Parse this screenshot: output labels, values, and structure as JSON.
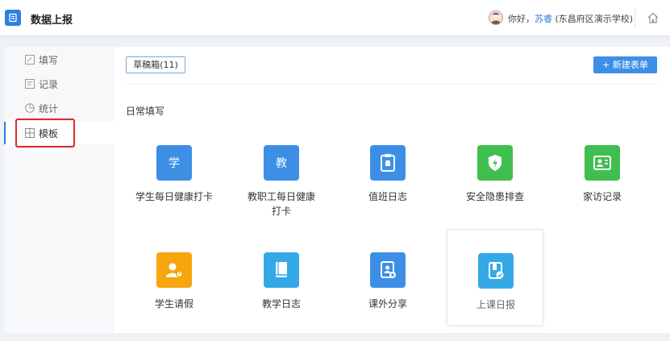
{
  "header": {
    "app_title": "数据上报",
    "greeting": "你好，",
    "user_name": "苏睿",
    "org": " (东昌府区演示学校)"
  },
  "sidebar": {
    "items": [
      {
        "label": "填写",
        "icon": "edit-icon"
      },
      {
        "label": "记录",
        "icon": "record-icon"
      },
      {
        "label": "统计",
        "icon": "pie-chart-icon"
      },
      {
        "label": "模板",
        "icon": "template-icon",
        "active": true
      }
    ]
  },
  "main": {
    "drafts_label": "草稿箱(11)",
    "new_form_label": "+ 新建表单",
    "section_title": "日常填写",
    "cards": [
      {
        "label": "学生每日健康打卡",
        "icon_text": "学",
        "color": "#3d8fe6"
      },
      {
        "label": "教职工每日健康打卡",
        "icon_text": "教",
        "color": "#3d8fe6"
      },
      {
        "label": "值班日志",
        "icon": "duty-log-icon",
        "color": "#3d8fe6"
      },
      {
        "label": "安全隐患排查",
        "icon": "shield-icon",
        "color": "#3fbf4f"
      },
      {
        "label": "家访记录",
        "icon": "contact-card-icon",
        "color": "#3fbf4f"
      },
      {
        "label": "学生请假",
        "icon": "user-leave-icon",
        "color": "#f7a60e"
      },
      {
        "label": "教学日志",
        "icon": "book-icon",
        "color": "#35a9e6"
      },
      {
        "label": "课外分享",
        "icon": "share-icon",
        "color": "#3d8fe6"
      },
      {
        "label": "上课日报",
        "icon": "daily-report-icon",
        "color": "#35a9e6"
      }
    ]
  },
  "colors": {
    "accent": "#2f7fe0",
    "highlight_box": "#e0282c"
  }
}
